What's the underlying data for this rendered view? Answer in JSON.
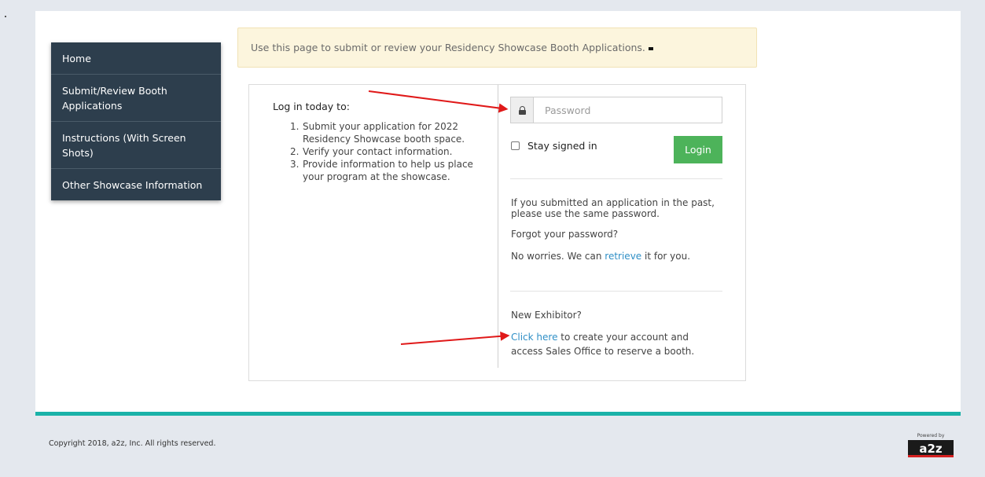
{
  "sidebar": {
    "items": [
      {
        "label": "Home"
      },
      {
        "label": "Submit/Review Booth Applications"
      },
      {
        "label": "Instructions (With Screen Shots)"
      },
      {
        "label": "Other Showcase Information"
      }
    ]
  },
  "notice": {
    "text": "Use this page to submit or review your Residency Showcase Booth Applications."
  },
  "login": {
    "title": "Log in today to:",
    "steps": [
      {
        "num": "1.",
        "text": "Submit your application for 2022 Residency Showcase booth space."
      },
      {
        "num": "2.",
        "text": "Verify your contact information."
      },
      {
        "num": "3.",
        "text": "Provide information to help us place your program at the showcase."
      }
    ],
    "password_placeholder": "Password",
    "stay_signed_in": "Stay signed in",
    "login_button": "Login",
    "past_app_text": "If you submitted an application in the past, please use the same password.",
    "forgot_text": "Forgot your password?",
    "no_worries_prefix": "No worries.  We can ",
    "retrieve_link": "retrieve",
    "no_worries_suffix": " it for you.",
    "new_exhibitor": "New Exhibitor?",
    "click_here_link": "Click here",
    "create_account_suffix": " to create your account and",
    "create_account_line2": "access Sales Office to reserve a booth."
  },
  "footer": {
    "copyright": "Copyright 2018, a2z, Inc. All rights reserved.",
    "powered_by": "Powered by",
    "logo": "a2z"
  },
  "colors": {
    "sidebar_bg": "#2d3e4d",
    "accent_teal": "#1ab2a8",
    "login_green": "#4db35a",
    "link_blue": "#2f8fc6",
    "annotation_red": "#e01919"
  }
}
